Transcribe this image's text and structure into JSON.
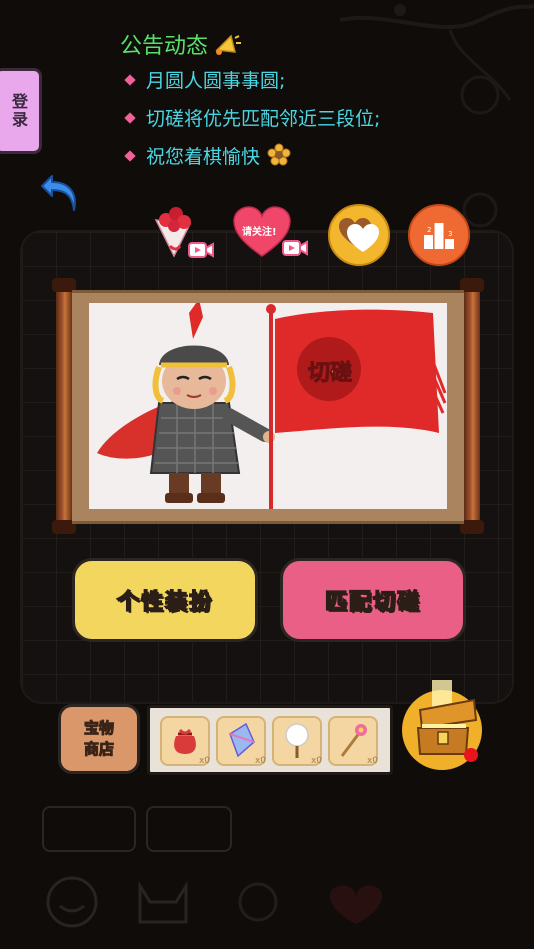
{
  "announcement": {
    "title": "公告动态",
    "lines": [
      "月圆人圆事事圆;",
      "切磋将优先匹配邻近三段位;",
      "祝您着棋愉快"
    ]
  },
  "side_tab": {
    "label": "登录"
  },
  "gifts": {
    "heart_bubble_text": "请关注!"
  },
  "banner": {
    "flag_text": "切磋"
  },
  "buttons": {
    "dress_up": "个性装扮",
    "match": "匹配切磋"
  },
  "shop": {
    "line1": "宝物",
    "line2": "商店"
  },
  "items": [
    {
      "name": "pouch",
      "count": "x0"
    },
    {
      "name": "crystal",
      "count": "x0"
    },
    {
      "name": "fan",
      "count": "x0"
    },
    {
      "name": "wand",
      "count": "x0"
    }
  ],
  "colors": {
    "announce_title": "#57e16a",
    "announce_text": "#4ad6e3",
    "dress_up_button": "#f2d65e",
    "match_button": "#ea5f86",
    "flag_red": "#e02a2a"
  }
}
